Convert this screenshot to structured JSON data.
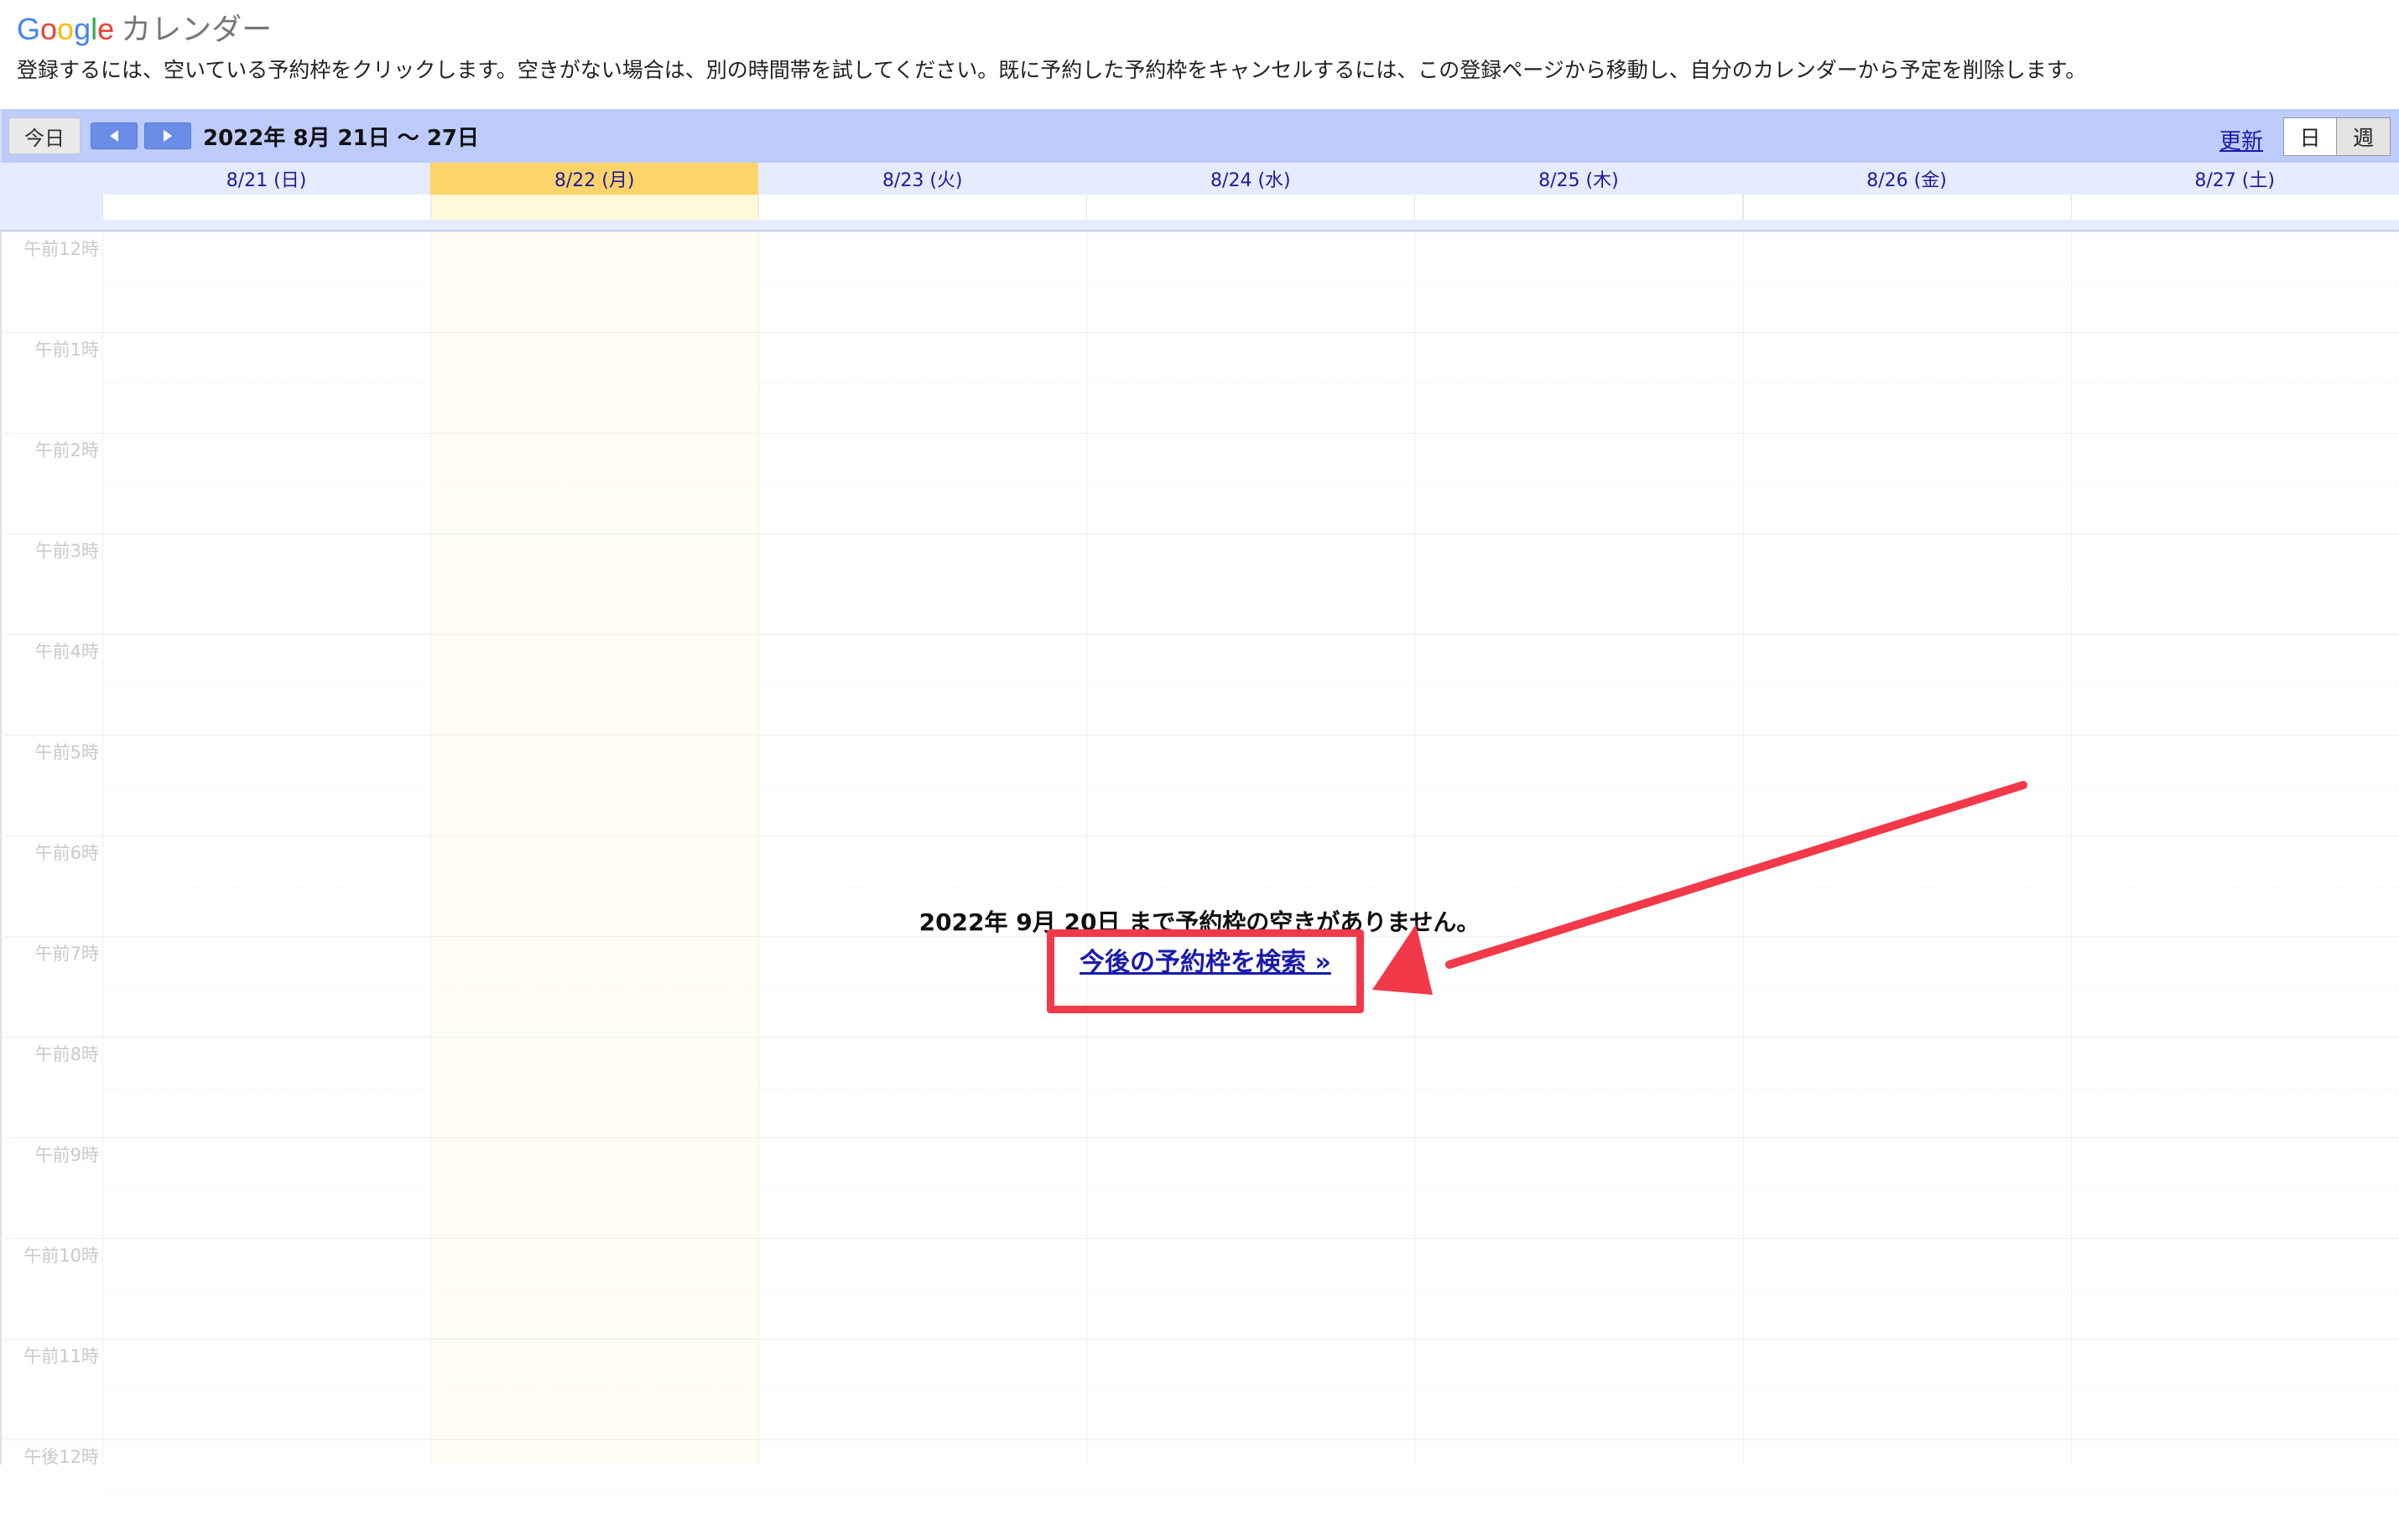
{
  "header": {
    "logo": {
      "google_letters": [
        {
          "char": "G",
          "color": "#4285F4"
        },
        {
          "char": "o",
          "color": "#EA4335"
        },
        {
          "char": "o",
          "color": "#FBBC05"
        },
        {
          "char": "g",
          "color": "#4285F4"
        },
        {
          "char": "l",
          "color": "#34A853"
        },
        {
          "char": "e",
          "color": "#EA4335"
        }
      ],
      "product": "カレンダー"
    },
    "instructions": "登録するには、空いている予約枠をクリックします。空きがない場合は、別の時間帯を試してください。既に予約した予約枠をキャンセルするには、この登録ページから移動し、自分のカレンダーから予定を削除します。"
  },
  "toolbar": {
    "today_label": "今日",
    "prev_icon": "triangle-left-icon",
    "next_icon": "triangle-right-icon",
    "date_range": "2022年 8月 21日 〜 27日",
    "refresh_label": "更新",
    "views": {
      "day": "日",
      "week": "週"
    }
  },
  "days": [
    {
      "label": "8/21 (日)",
      "today": false
    },
    {
      "label": "8/22 (月)",
      "today": true
    },
    {
      "label": "8/23 (火)",
      "today": false
    },
    {
      "label": "8/24 (水)",
      "today": false
    },
    {
      "label": "8/25 (木)",
      "today": false
    },
    {
      "label": "8/26 (金)",
      "today": false
    },
    {
      "label": "8/27 (土)",
      "today": false
    }
  ],
  "hours": [
    "午前12時",
    "午前1時",
    "午前2時",
    "午前3時",
    "午前4時",
    "午前5時",
    "午前6時",
    "午前7時",
    "午前8時",
    "午前9時",
    "午前10時",
    "午前11時",
    "午後12時"
  ],
  "message": {
    "no_slots": "2022年 9月 20日 まで予約枠の空きがありません。",
    "find_link": "今後の予約枠を検索 »"
  },
  "annotation": {
    "color": "#f2394a"
  }
}
